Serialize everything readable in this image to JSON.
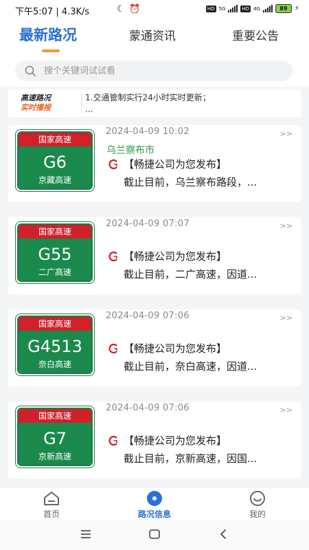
{
  "status_bar": {
    "time_speed": "下午5:07 | 4.3K/s",
    "hd1": "HD",
    "net1": "5G",
    "hd2": "HD",
    "net2": "4G",
    "battery": "89"
  },
  "top_tabs": [
    {
      "label": "最新路况",
      "active": true
    },
    {
      "label": "蒙通资讯",
      "active": false
    },
    {
      "label": "重要公告",
      "active": false
    }
  ],
  "search": {
    "placeholder": "搜个关键词试试看"
  },
  "notice": {
    "logo_line1": "高速路况",
    "logo_line2": "实时播报",
    "line1": "1.交通管制实行24小时实时更新；",
    "line2": "..."
  },
  "cards": [
    {
      "sign_top": "国家高速",
      "code": "G6",
      "name": "京藏高速",
      "time": "2024-04-09 10:02",
      "more": ">>",
      "region": "乌兰察布市",
      "title": "【畅捷公司为您发布】",
      "desc": "截止目前，乌兰察布路段，..."
    },
    {
      "sign_top": "国家高速",
      "code": "G55",
      "name": "二广高速",
      "time": "2024-04-09 07:07",
      "more": ">>",
      "region": "",
      "title": "【畅捷公司为您发布】",
      "desc": "截止目前，二广高速，因道..."
    },
    {
      "sign_top": "国家高速",
      "code": "G4513",
      "name": "奈白高速",
      "time": "2024-04-09 07:06",
      "more": ">>",
      "region": "",
      "title": "【畅捷公司为您发布】",
      "desc": "截止目前，奈白高速，因道..."
    },
    {
      "sign_top": "国家高速",
      "code": "G7",
      "name": "京新高速",
      "time": "2024-04-09 07:06",
      "more": ">>",
      "region": "",
      "title": "【畅捷公司为您发布】",
      "desc": "截止目前，京新高速，因国..."
    }
  ],
  "bottom_nav": [
    {
      "label": "首页",
      "icon": "home-icon",
      "active": false
    },
    {
      "label": "路况信息",
      "icon": "road-info-icon",
      "active": true
    },
    {
      "label": "我的",
      "icon": "profile-icon",
      "active": false
    }
  ],
  "colors": {
    "accent": "#2b6fd6",
    "underline": "#f39a2b",
    "sign_red": "#d0212b",
    "sign_green": "#1a8a4c",
    "region_green": "#2f9a4e"
  }
}
